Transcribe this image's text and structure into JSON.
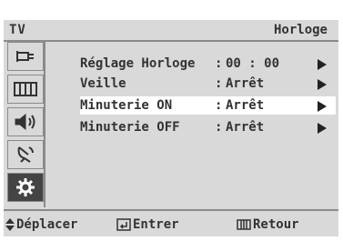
{
  "header": {
    "tv_label": "TV",
    "title": "Horloge"
  },
  "sidebar": {
    "icons": [
      "input-icon",
      "picture-icon",
      "sound-icon",
      "channel-antenna-icon",
      "setup-gear-icon"
    ],
    "active_index": 4
  },
  "menu": {
    "items": [
      {
        "label": "Réglage Horloge",
        "value": "00 : 00",
        "selected": false
      },
      {
        "label": "Veille",
        "value": "Arrêt",
        "selected": false
      },
      {
        "label": "Minuterie ON",
        "value": "Arrêt",
        "selected": true
      },
      {
        "label": "Minuterie OFF",
        "value": "Arrêt",
        "selected": false
      }
    ],
    "separator": ":"
  },
  "footer": {
    "move": "Déplacer",
    "enter": "Entrer",
    "back": "Retour"
  }
}
